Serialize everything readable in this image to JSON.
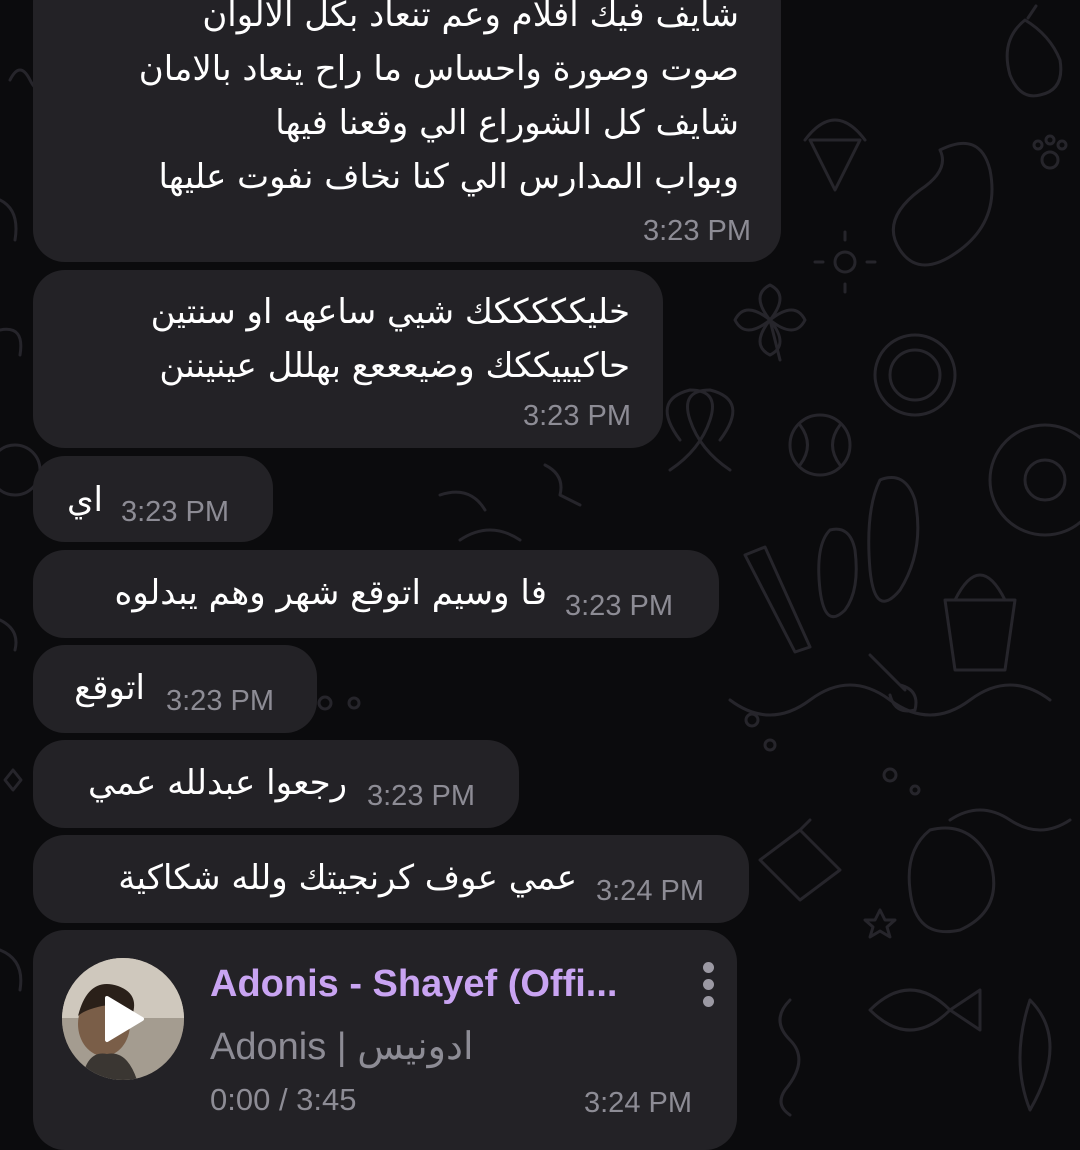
{
  "colors": {
    "background": "#0b0b0d",
    "bubble": "#232226",
    "text": "#ffffff",
    "meta": "#8d8c95",
    "accent": "#c9a4f2"
  },
  "messages": [
    {
      "lines": [
        "شايف فيك افلام وعم تنعاد بكل الالوان",
        "صوت وصورة واحساس ما راح ينعاد بالامان",
        "شايف كل الشوراع الي وقعنا فيها",
        "وبواب المدارس الي كنا نخاف نفوت عليها"
      ],
      "time": "3:23 PM"
    },
    {
      "lines": [
        "خليكككككك شيي ساعهه او سنتين",
        "حاكيييككك وضيعععع بهللل عينيننن"
      ],
      "time": "3:23 PM"
    },
    {
      "lines": [
        "اي"
      ],
      "time": "3:23 PM"
    },
    {
      "lines": [
        "فا وسيم اتوقع شهر وهم يبدلوه"
      ],
      "time": "3:23 PM"
    },
    {
      "lines": [
        "اتوقع"
      ],
      "time": "3:23 PM"
    },
    {
      "lines": [
        "رجعوا عبدلله عمي"
      ],
      "time": "3:23 PM"
    },
    {
      "lines": [
        "عمي عوف كرنجيتك ولله شكاكية"
      ],
      "time": "3:24 PM"
    }
  ],
  "audio": {
    "title": "Adonis - Shayef (Offi...",
    "artist": "Adonis | ادونيس",
    "progress": "0:00 / 3:45",
    "time": "3:24 PM",
    "icons": {
      "play": "play-icon",
      "menu": "more-vertical-icon"
    }
  }
}
